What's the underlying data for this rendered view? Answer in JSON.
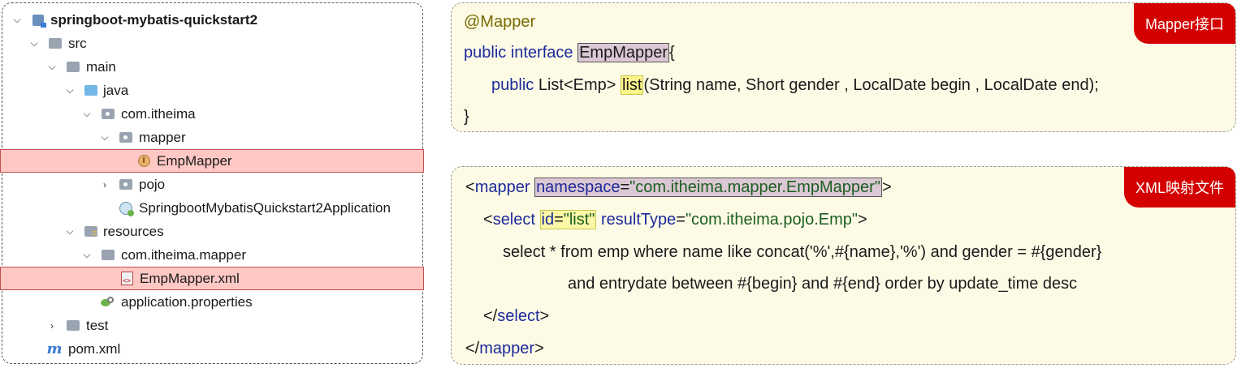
{
  "tree": {
    "project": "springboot-mybatis-quickstart2",
    "src": "src",
    "main": "main",
    "java": "java",
    "pkg_root": "com.itheima",
    "pkg_mapper": "mapper",
    "emp_mapper": "EmpMapper",
    "pkg_pojo": "pojo",
    "app_class": "SpringbootMybatisQuickstart2Application",
    "resources": "resources",
    "res_pkg": "com.itheima.mapper",
    "xml_file": "EmpMapper.xml",
    "props": "application.properties",
    "test": "test",
    "pom": "pom.xml",
    "maven_icon": "m"
  },
  "mapper_panel": {
    "badge": "Mapper接口",
    "annotation": "@Mapper",
    "line2_kw": "public interface",
    "line2_name": "EmpMapper",
    "line2_brace": "{",
    "line3_kw": "public",
    "line3_type": "List<Emp>",
    "line3_method": "list",
    "line3_params": "(String name, Short gender , LocalDate begin , LocalDate end);",
    "line4": "}"
  },
  "xml_panel": {
    "badge": "XML映射文件",
    "l1_open": "<",
    "l1_tag": "mapper",
    "l1_attr": "namespace",
    "l1_eq": "=",
    "l1_val": "\"com.itheima.mapper.EmpMapper\"",
    "l1_close": ">",
    "l2_open": "<",
    "l2_tag": "select",
    "l2_id_attr": "id",
    "l2_id_eq": "=",
    "l2_id_val": "\"list\"",
    "l2_rt_attr": "resultType",
    "l2_rt_eq": "=",
    "l2_rt_val": "\"com.itheima.pojo.Emp\"",
    "l2_close": ">",
    "l3": "select * from emp where name like concat('%',#{name},'%') and gender = #{gender}",
    "l4": "and entrydate between #{begin} and #{end} order by update_time desc",
    "l5_open": "</",
    "l5_tag": "select",
    "l5_close": ">",
    "l6_open": "</",
    "l6_tag": "mapper",
    "l6_close": ">"
  }
}
